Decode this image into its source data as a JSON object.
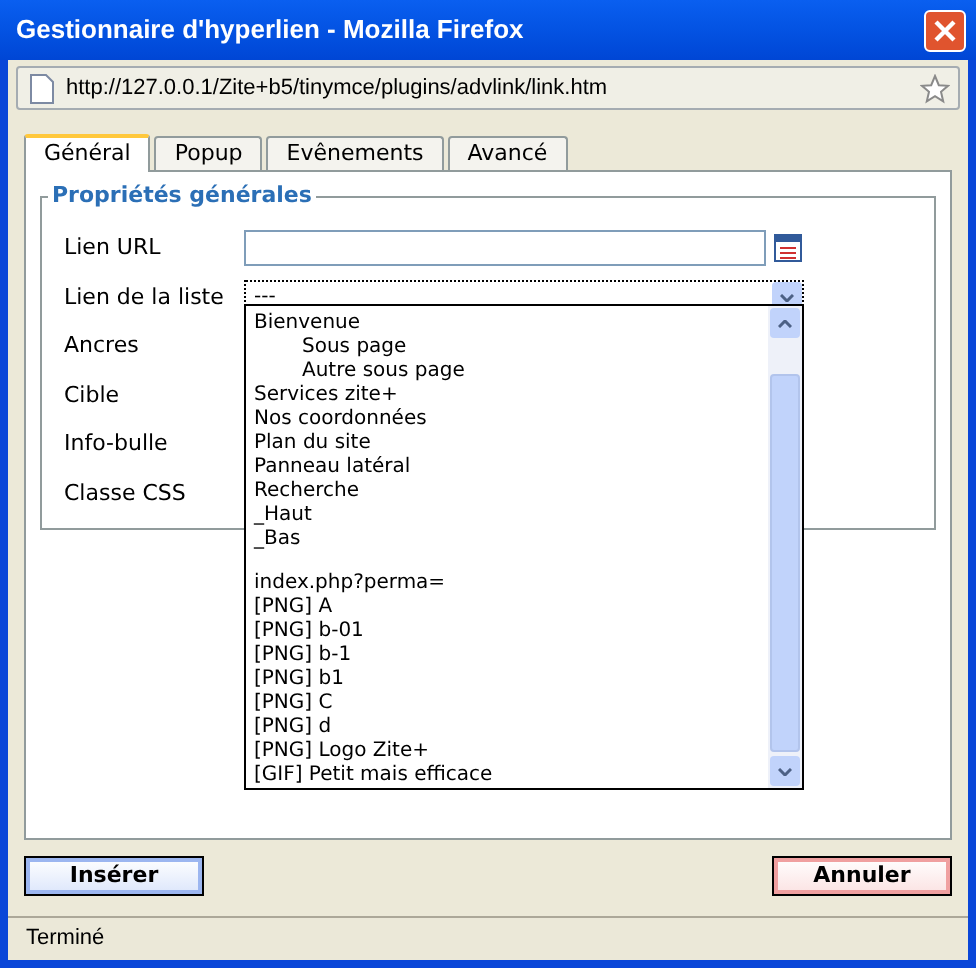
{
  "window": {
    "title": "Gestionnaire d'hyperlien - Mozilla Firefox"
  },
  "address_bar": {
    "url": "http://127.0.0.1/Zite+b5/tinymce/plugins/advlink/link.htm"
  },
  "tabs": [
    {
      "label": "Général",
      "selected": true
    },
    {
      "label": "Popup",
      "selected": false
    },
    {
      "label": "Evênements",
      "selected": false
    },
    {
      "label": "Avancé",
      "selected": false
    }
  ],
  "fieldset": {
    "legend": "Propriétés générales",
    "fields": [
      {
        "label": "Lien URL",
        "kind": "url"
      },
      {
        "label": "Lien de la liste",
        "kind": "select",
        "value": "---"
      },
      {
        "label": "Ancres",
        "kind": "hidden"
      },
      {
        "label": "Cible",
        "kind": "hidden"
      },
      {
        "label": "Info-bulle",
        "kind": "hidden"
      },
      {
        "label": "Classe CSS",
        "kind": "hidden"
      }
    ]
  },
  "dropdown_list": {
    "items": [
      {
        "kind": "option",
        "label": "Bienvenue",
        "children": [
          {
            "kind": "option",
            "label": "Sous page"
          },
          {
            "kind": "option",
            "label": "Autre sous page"
          }
        ]
      },
      {
        "kind": "option",
        "label": "Services zite+"
      },
      {
        "kind": "option",
        "label": "Nos coordonnées"
      },
      {
        "kind": "option",
        "label": "Plan du site"
      },
      {
        "kind": "option",
        "label": "Panneau latéral"
      },
      {
        "kind": "option",
        "label": "Recherche"
      },
      {
        "kind": "option",
        "label": "_Haut"
      },
      {
        "kind": "option",
        "label": "_Bas"
      },
      {
        "kind": "spacer"
      },
      {
        "kind": "option",
        "label": "index.php?perma="
      },
      {
        "kind": "option",
        "label": "[PNG] A"
      },
      {
        "kind": "option",
        "label": "[PNG] b-01"
      },
      {
        "kind": "option",
        "label": "[PNG] b-1"
      },
      {
        "kind": "option",
        "label": "[PNG] b1"
      },
      {
        "kind": "option",
        "label": "[PNG] C"
      },
      {
        "kind": "option",
        "label": "[PNG] d"
      },
      {
        "kind": "option",
        "label": "[PNG] Logo Zite+"
      },
      {
        "kind": "option",
        "label": "[GIF] Petit mais efficace"
      }
    ]
  },
  "buttons": [
    {
      "label": "Insérer",
      "kind": "primary"
    },
    {
      "label": "Annuler",
      "kind": "cancel"
    }
  ],
  "status_bar": {
    "text": "Terminé"
  }
}
